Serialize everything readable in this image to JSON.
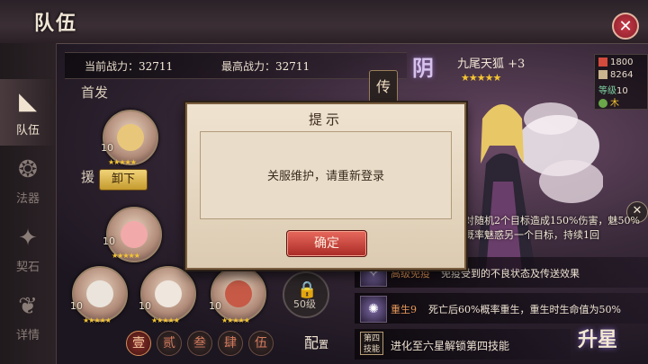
{
  "header": {
    "title": "队伍",
    "close_glyph": "✕"
  },
  "nav": [
    {
      "label": "队伍",
      "icon": "team-icon",
      "glyph": "◣",
      "active": true
    },
    {
      "label": "法器",
      "icon": "artifact-icon",
      "glyph": "❂",
      "active": false
    },
    {
      "label": "契石",
      "icon": "contract-stone-icon",
      "glyph": "✦",
      "active": false
    },
    {
      "label": "详情",
      "icon": "details-icon",
      "glyph": "❦",
      "active": false
    }
  ],
  "stats": {
    "current_label": "当前战力：",
    "current_value": "32711",
    "max_label": "最高战力：",
    "max_value": "32711"
  },
  "sections": {
    "lead": "首发",
    "support": "援"
  },
  "heroes": [
    {
      "level": "10",
      "stars": "★★★★★",
      "color": "#e8c77a"
    },
    {
      "level": "10",
      "stars": "★★★★★",
      "color": "#f1a9a9"
    },
    {
      "level": "10",
      "stars": "★★★★★",
      "color": "#eae4dc"
    },
    {
      "level": "10",
      "stars": "★★★★★",
      "color": "#efe6dd"
    },
    {
      "level": "10",
      "stars": "★★★★★",
      "color": "#c65a47"
    }
  ],
  "unequip_label": "卸下",
  "lock": {
    "glyph": "🔒",
    "label": "50级"
  },
  "team_tabs": [
    "壹",
    "贰",
    "叁",
    "肆",
    "伍"
  ],
  "config": {
    "main": "配",
    "sub": "置"
  },
  "detail": {
    "yin": "阴",
    "chuan": "传",
    "name": "九尾天狐 +3",
    "stars": "★★★★★",
    "attack": "1800",
    "hp": "8264",
    "level_label": "等级",
    "level_value": "10",
    "element": "木",
    "skill_desc": "对随机2个目标造成150%伤害，魅50%概率魅惑另一个目标，持续1回",
    "close_glyph": "✕"
  },
  "skills": [
    {
      "name": "高级免疫",
      "text": "免疫受到的不良状态及传送效果",
      "glyph": "✧"
    },
    {
      "name": "重生9",
      "text": "死亡后60%概率重生，重生时生命值为50%",
      "glyph": "✺"
    }
  ],
  "skill4": {
    "box": "第四技能",
    "text": "进化至六星解锁第四技能"
  },
  "upgrade": "升星",
  "modal": {
    "title": "提示",
    "message": "关服维护，请重新登录",
    "ok": "确定"
  },
  "colors": {
    "accent": "#c73a48",
    "gold": "#f4c531",
    "modal_bg": "#efe3d0"
  }
}
